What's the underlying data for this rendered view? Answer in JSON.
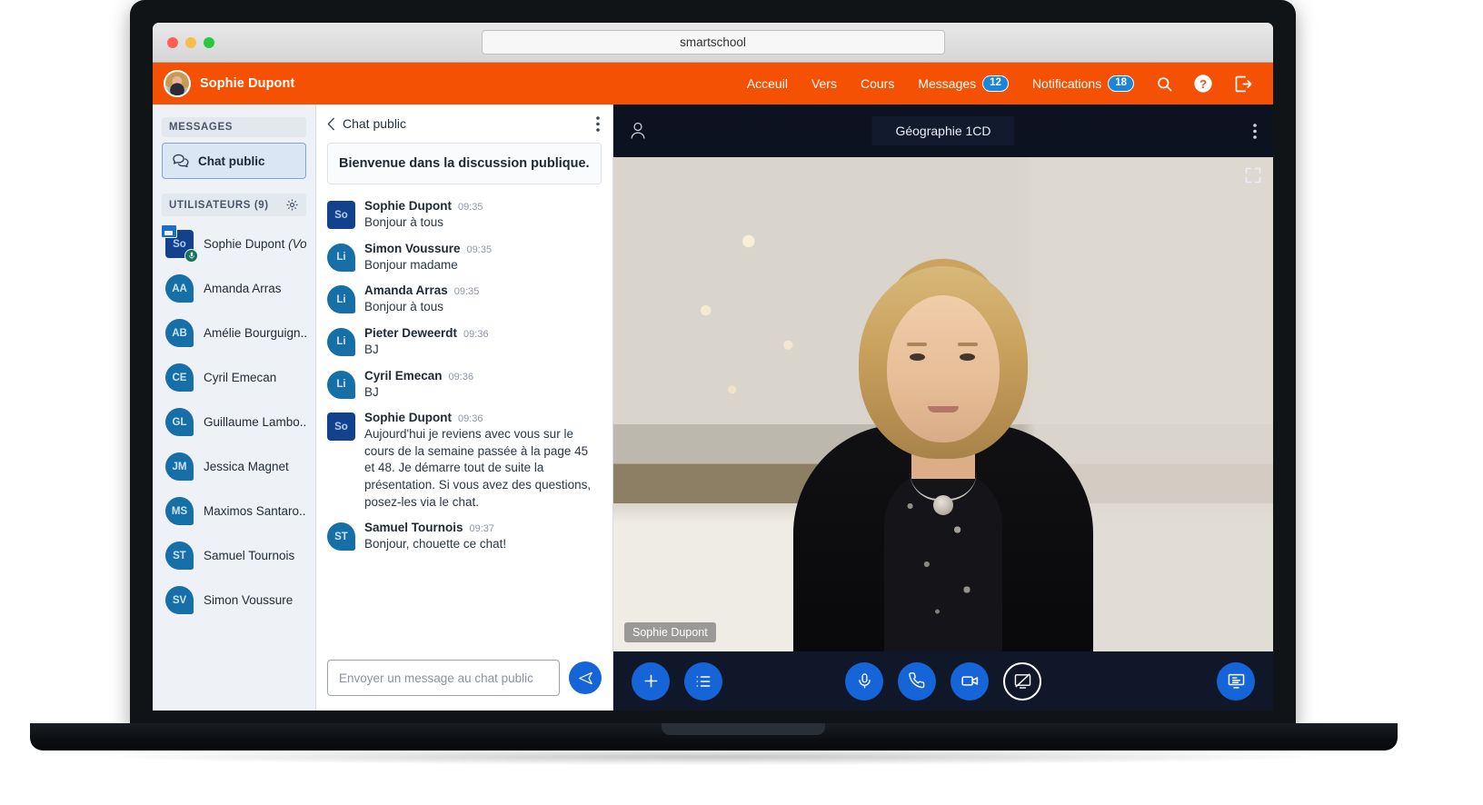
{
  "browser": {
    "url": "smartschool",
    "traffic_lights": [
      "close",
      "minimize",
      "maximize"
    ]
  },
  "appbar": {
    "brand_name": "Sophie Dupont",
    "avatar_icon": "user-photo-avatar",
    "nav": [
      {
        "label": "Acceuil",
        "badge": null
      },
      {
        "label": "Vers",
        "badge": null
      },
      {
        "label": "Cours",
        "badge": null
      },
      {
        "label": "Messages",
        "badge": "12"
      },
      {
        "label": "Notifications",
        "badge": "18"
      }
    ],
    "icons": [
      "search-icon",
      "help-icon",
      "logout-icon"
    ],
    "accent_color": "#f55105",
    "badge_color": "#1b86d8"
  },
  "sidebar": {
    "messages_section": {
      "title": "MESSAGES",
      "items": [
        {
          "label": "Chat public",
          "icon": "chat-bubbles-icon",
          "selected": true
        }
      ]
    },
    "users_section": {
      "title": "UTILISATEURS (9)",
      "settings_icon": "gear-icon",
      "users": [
        {
          "initials": "So",
          "name": "Sophie Dupont ",
          "suffix": "(Vo..",
          "presenter": true,
          "mic": true
        },
        {
          "initials": "AA",
          "name": "Amanda Arras",
          "presenter": false,
          "mic": false
        },
        {
          "initials": "AB",
          "name": "Amélie Bourguign..",
          "presenter": false,
          "mic": false
        },
        {
          "initials": "CE",
          "name": "Cyril Emecan",
          "presenter": false,
          "mic": false
        },
        {
          "initials": "GL",
          "name": "Guillaume Lambo...",
          "presenter": false,
          "mic": false
        },
        {
          "initials": "JM",
          "name": "Jessica Magnet",
          "presenter": false,
          "mic": false
        },
        {
          "initials": "MS",
          "name": "Maximos Santaro...",
          "presenter": false,
          "mic": false
        },
        {
          "initials": "ST",
          "name": "Samuel Tournois",
          "presenter": false,
          "mic": false
        },
        {
          "initials": "SV",
          "name": "Simon Voussure",
          "presenter": false,
          "mic": false
        }
      ]
    }
  },
  "chat": {
    "header": {
      "back_icon": "chevron-left-icon",
      "title": "Chat public",
      "menu_icon": "kebab-menu-icon"
    },
    "welcome_notice": "Bienvenue dans la discussion publique.",
    "messages": [
      {
        "initials": "So",
        "square": true,
        "author": "Sophie Dupont",
        "time": "09:35",
        "text": "Bonjour à tous"
      },
      {
        "initials": "Li",
        "square": false,
        "author": "Simon Voussure",
        "time": "09:35",
        "text": "Bonjour madame"
      },
      {
        "initials": "Li",
        "square": false,
        "author": "Amanda Arras",
        "time": "09:35",
        "text": "Bonjour à tous"
      },
      {
        "initials": "Li",
        "square": false,
        "author": "Pieter Deweerdt",
        "time": "09:36",
        "text": "BJ"
      },
      {
        "initials": "Li",
        "square": false,
        "author": "Cyril Emecan",
        "time": "09:36",
        "text": "BJ"
      },
      {
        "initials": "So",
        "square": true,
        "author": "Sophie Dupont",
        "time": "09:36",
        "text": "Aujourd'hui je reviens avec vous sur le cours de la semaine passée à la page 45 et 48. Je démarre tout de suite la présentation. Si vous avez des questions, posez-les via le chat."
      },
      {
        "initials": "ST",
        "square": false,
        "author": "Samuel Tournois",
        "time": "09:37",
        "text": "Bonjour, chouette ce chat!"
      }
    ],
    "input_placeholder": "Envoyer un message au chat public",
    "input_value": "",
    "send_icon": "send-paper-plane-icon"
  },
  "video": {
    "header": {
      "person_icon": "user-outline-icon",
      "title": "Géographie 1CD",
      "menu_icon": "kebab-menu-icon"
    },
    "expand_icon": "fullscreen-expand-icon",
    "name_tag": "Sophie Dupont",
    "toolbar": {
      "left": [
        {
          "icon": "plus-icon",
          "name": "add-button",
          "style": "filled"
        },
        {
          "icon": "list-icon",
          "name": "actions-list-button",
          "style": "filled"
        }
      ],
      "center": [
        {
          "icon": "microphone-icon",
          "name": "microphone-button",
          "style": "filled"
        },
        {
          "icon": "phone-icon",
          "name": "leave-audio-button",
          "style": "filled"
        },
        {
          "icon": "video-camera-icon",
          "name": "camera-button",
          "style": "filled"
        },
        {
          "icon": "screen-share-off-icon",
          "name": "screen-share-button",
          "style": "outline"
        }
      ],
      "right": [
        {
          "icon": "presentation-screen-icon",
          "name": "presentation-button",
          "style": "filled"
        }
      ],
      "button_color": "#1565d8"
    }
  }
}
